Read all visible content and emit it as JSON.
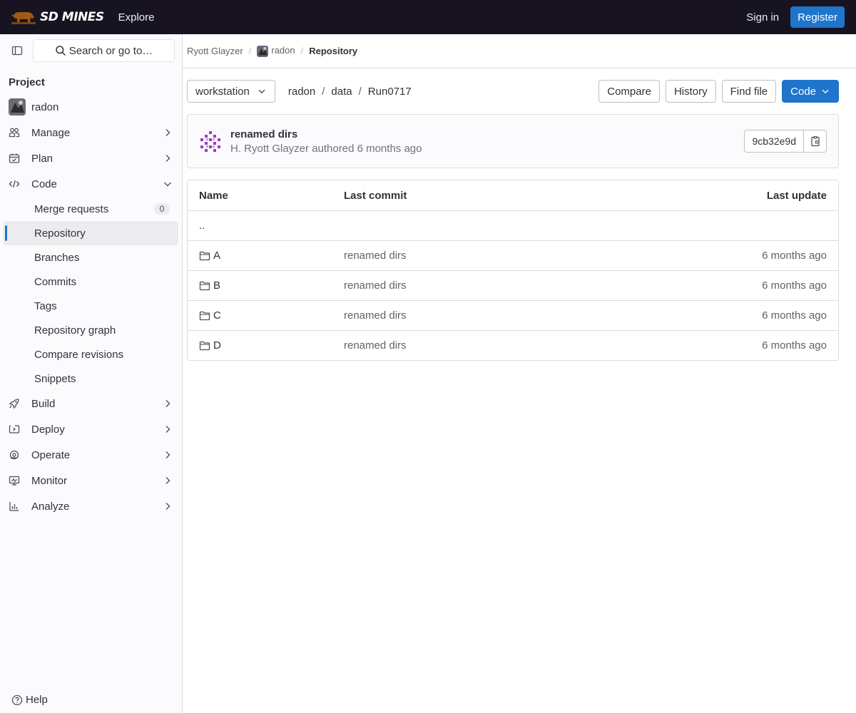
{
  "topbar": {
    "brand": "SD MINES",
    "explore": "Explore",
    "signin": "Sign in",
    "register": "Register",
    "brand_color": "#171321"
  },
  "sidebar": {
    "search_label": "Search or go to…",
    "heading": "Project",
    "project_name": "radon",
    "items": [
      {
        "label": "Manage",
        "icon": "users-icon"
      },
      {
        "label": "Plan",
        "icon": "calendar-icon"
      },
      {
        "label": "Code",
        "icon": "code-icon"
      }
    ],
    "code_sub": [
      {
        "label": "Merge requests",
        "badge": "0"
      },
      {
        "label": "Repository",
        "active": true
      },
      {
        "label": "Branches"
      },
      {
        "label": "Commits"
      },
      {
        "label": "Tags"
      },
      {
        "label": "Repository graph"
      },
      {
        "label": "Compare revisions"
      },
      {
        "label": "Snippets"
      }
    ],
    "more": [
      {
        "label": "Build",
        "icon": "rocket-icon"
      },
      {
        "label": "Deploy",
        "icon": "deploy-icon"
      },
      {
        "label": "Operate",
        "icon": "cloud-gear-icon"
      },
      {
        "label": "Monitor",
        "icon": "monitor-icon"
      },
      {
        "label": "Analyze",
        "icon": "chart-icon"
      }
    ],
    "help": "Help"
  },
  "breadcrumb": {
    "owner": "Ryott Glayzer",
    "project": "radon",
    "current": "Repository"
  },
  "toolbar": {
    "branch": "workstation",
    "path": [
      "radon",
      "data",
      "Run0717"
    ],
    "compare": "Compare",
    "history": "History",
    "find_file": "Find file",
    "code": "Code",
    "accent": "#1f75cb"
  },
  "commit": {
    "title": "renamed dirs",
    "author": "H. Ryott Glayzer",
    "meta_suffix": "authored 6 months ago",
    "sha": "9cb32e9d"
  },
  "table": {
    "headers": {
      "name": "Name",
      "last_commit": "Last commit",
      "last_update": "Last update"
    },
    "parent": "..",
    "rows": [
      {
        "name": "A",
        "commit": "renamed dirs",
        "updated": "6 months ago"
      },
      {
        "name": "B",
        "commit": "renamed dirs",
        "updated": "6 months ago"
      },
      {
        "name": "C",
        "commit": "renamed dirs",
        "updated": "6 months ago"
      },
      {
        "name": "D",
        "commit": "renamed dirs",
        "updated": "6 months ago"
      }
    ]
  }
}
